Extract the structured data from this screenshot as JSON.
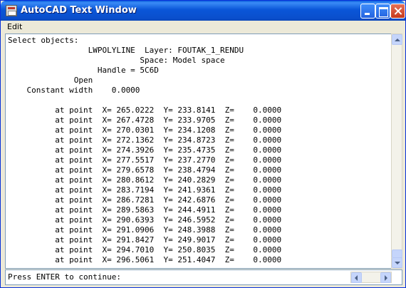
{
  "window": {
    "title": "AutoCAD Text Window"
  },
  "menu": {
    "items": [
      "Edit"
    ]
  },
  "text_lines": [
    "Select objects:",
    "                 LWPOLYLINE  Layer: FOUTAK_1_RENDU",
    "                            Space: Model space",
    "                   Handle = 5C6D",
    "              Open",
    "    Constant width    0.0000",
    "",
    "          at point  X= 265.0222  Y= 233.8141  Z=    0.0000",
    "          at point  X= 267.4728  Y= 233.9705  Z=    0.0000",
    "          at point  X= 270.0301  Y= 234.1208  Z=    0.0000",
    "          at point  X= 272.1362  Y= 234.8723  Z=    0.0000",
    "          at point  X= 274.3926  Y= 235.4735  Z=    0.0000",
    "          at point  X= 277.5517  Y= 237.2770  Z=    0.0000",
    "          at point  X= 279.6578  Y= 238.4794  Z=    0.0000",
    "          at point  X= 280.8612  Y= 240.2829  Z=    0.0000",
    "          at point  X= 283.7194  Y= 241.9361  Z=    0.0000",
    "          at point  X= 286.7281  Y= 242.6876  Z=    0.0000",
    "          at point  X= 289.5863  Y= 244.4911  Z=    0.0000",
    "          at point  X= 290.6393  Y= 246.5952  Z=    0.0000",
    "          at point  X= 291.0906  Y= 248.3988  Z=    0.0000",
    "          at point  X= 291.8427  Y= 249.9017  Z=    0.0000",
    "          at point  X= 294.7010  Y= 250.8035  Z=    0.0000",
    "          at point  X= 296.5061  Y= 251.4047  Z=    0.0000"
  ],
  "command_line": {
    "prompt": "Press ENTER to continue:"
  }
}
